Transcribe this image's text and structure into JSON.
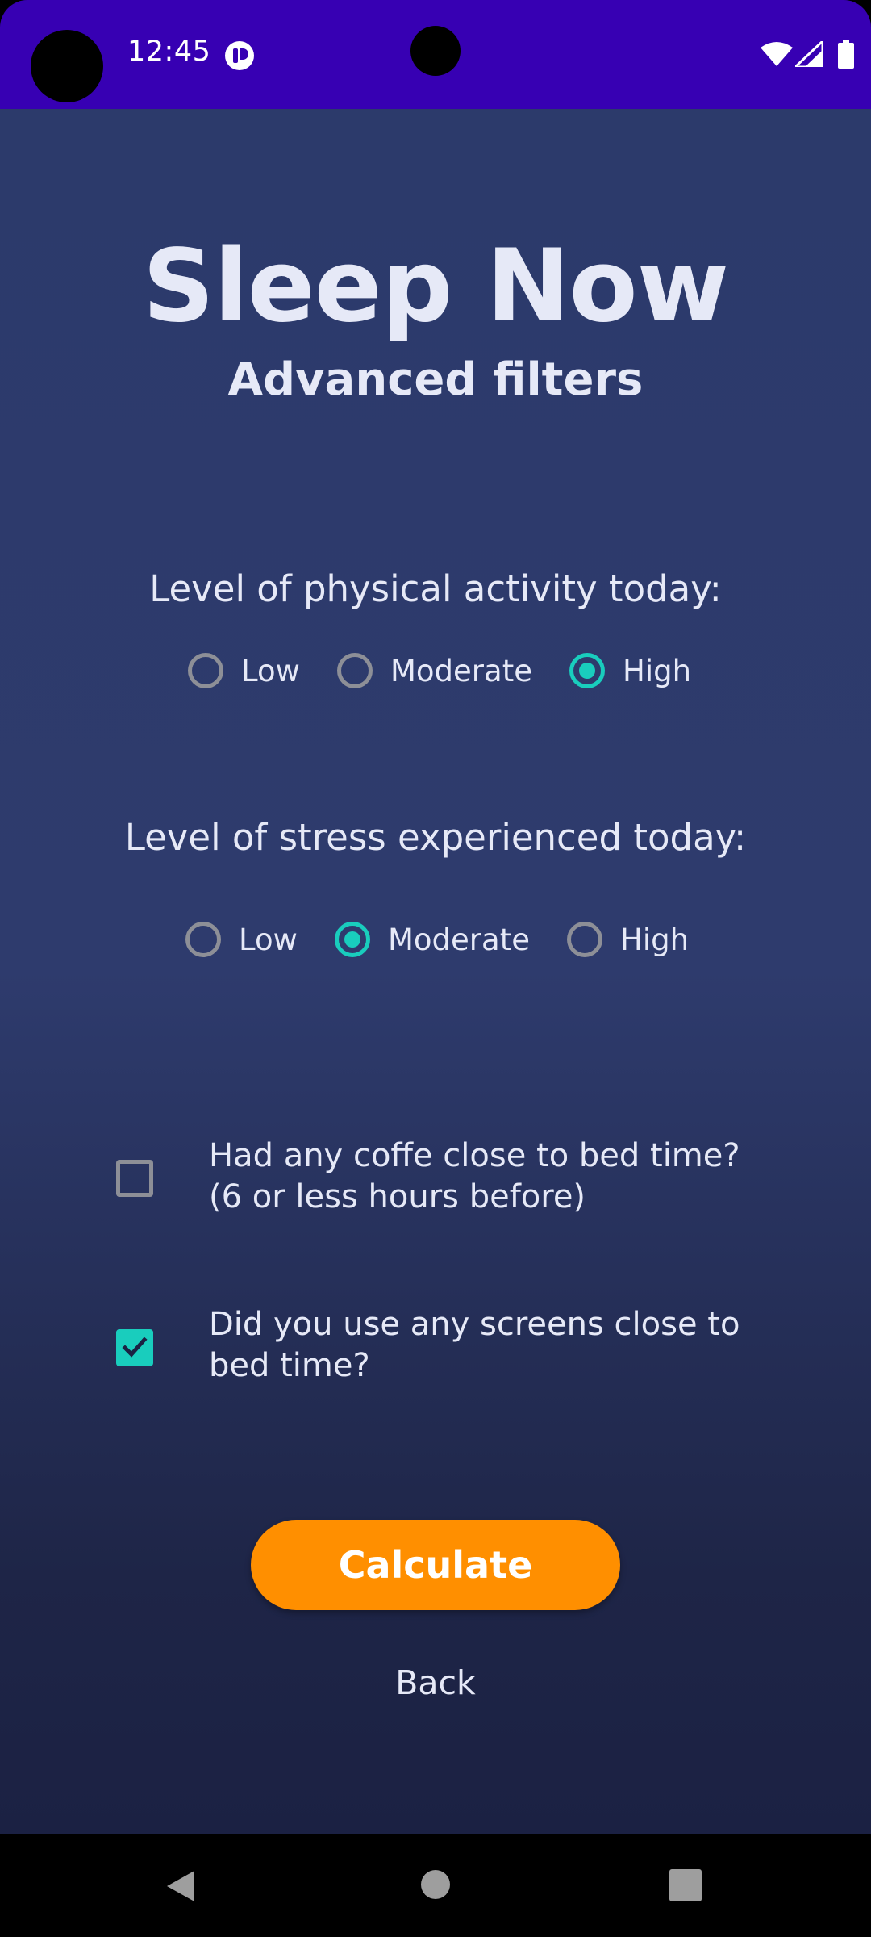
{
  "status_bar": {
    "time": "12:45",
    "icons": [
      "notification-app-icon",
      "wifi-icon",
      "signal-icon",
      "battery-icon"
    ]
  },
  "header": {
    "title": "Sleep Now",
    "subtitle": "Advanced filters"
  },
  "physical_activity": {
    "question": "Level of physical activity today:",
    "options": [
      "Low",
      "Moderate",
      "High"
    ],
    "selected": "High"
  },
  "stress": {
    "question": "Level of stress experienced today:",
    "options": [
      "Low",
      "Moderate",
      "High"
    ],
    "selected": "Moderate"
  },
  "coffee": {
    "line1": "Had any coffe close to bed time?",
    "line2": "(6 or less hours before)",
    "checked": false
  },
  "screens": {
    "line1": "Did you use any screens close to",
    "line2": "bed time?",
    "checked": true
  },
  "actions": {
    "calculate_label": "Calculate",
    "back_label": "Back"
  },
  "nav_bar": {
    "icons": [
      "back-icon",
      "home-icon",
      "recents-icon"
    ]
  },
  "colors": {
    "status_bar": "#3700b3",
    "background_top": "#2c3a6b",
    "background_bottom": "#1b2143",
    "accent": "#19cdbd",
    "button": "#ff8f00",
    "text": "#e6e9f7"
  }
}
